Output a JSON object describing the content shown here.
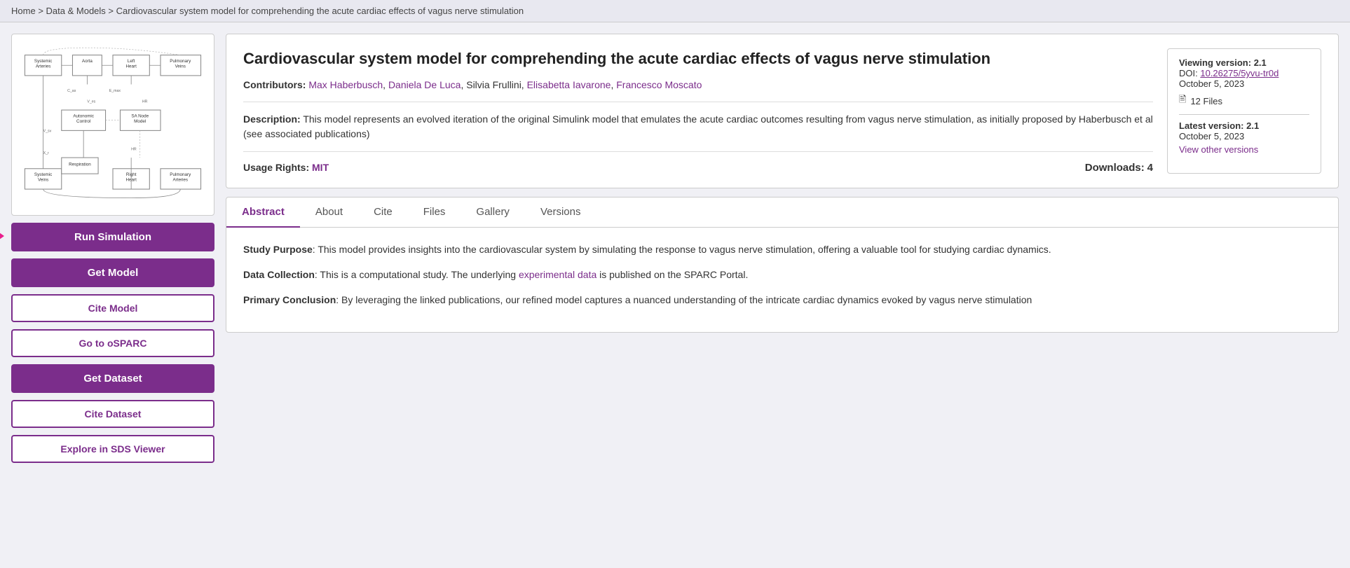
{
  "breadcrumb": {
    "home": "Home",
    "section": "Data & Models",
    "page": "Cardiovascular system model for comprehending the acute cardiac effects of vagus nerve stimulation",
    "separator": ">"
  },
  "model": {
    "title": "Cardiovascular system model for comprehending the acute cardiac effects of vagus nerve stimulation",
    "contributors_label": "Contributors:",
    "contributors": [
      {
        "name": "Max Haberbusch",
        "link": true
      },
      {
        "name": "Daniela De Luca",
        "link": true
      },
      {
        "name": "Silvia Frullini",
        "link": false
      },
      {
        "name": "Elisabetta Iavarone",
        "link": true
      },
      {
        "name": "Francesco Moscato",
        "link": true
      }
    ],
    "description_label": "Description:",
    "description": "This model represents an evolved iteration of the original Simulink model that emulates the acute cardiac outcomes resulting from vagus nerve stimulation, as initially proposed by Haberbusch et al (see associated publications)",
    "usage_rights_label": "Usage Rights:",
    "usage_rights": "MIT",
    "downloads_label": "Downloads:",
    "downloads_count": "4",
    "version_info": {
      "viewing_label": "Viewing version:",
      "viewing_version": "2.1",
      "doi_label": "DOI:",
      "doi": "10.26275/5yvu-tr0d",
      "date": "October 5, 2023",
      "files_count": "12 Files",
      "latest_label": "Latest version:",
      "latest_version": "2.1",
      "latest_date": "October 5, 2023",
      "view_other_versions": "View other versions"
    }
  },
  "tabs": {
    "items": [
      {
        "id": "abstract",
        "label": "Abstract",
        "active": true
      },
      {
        "id": "about",
        "label": "About"
      },
      {
        "id": "cite",
        "label": "Cite"
      },
      {
        "id": "files",
        "label": "Files"
      },
      {
        "id": "gallery",
        "label": "Gallery"
      },
      {
        "id": "versions",
        "label": "Versions"
      }
    ]
  },
  "abstract": {
    "study_purpose_label": "Study Purpose",
    "study_purpose_text": ": This model provides insights into the cardiovascular system by simulating the response to vagus nerve stimulation, offering a valuable tool for studying cardiac dynamics.",
    "data_collection_label": "Data Collection",
    "data_collection_text": ": This is a computational study. The underlying ",
    "exp_data_link": "experimental data",
    "data_collection_text2": " is published on the SPARC Portal.",
    "primary_conclusion_label": "Primary Conclusion",
    "primary_conclusion_text": ": By leveraging the linked publications, our refined model captures a nuanced understanding of the intricate cardiac dynamics evoked by vagus nerve stimulation"
  },
  "sidebar": {
    "run_simulation": "Run Simulation",
    "get_model": "Get Model",
    "cite_model": "Cite Model",
    "go_to_osparc": "Go to oSPARC",
    "get_dataset": "Get Dataset",
    "cite_dataset": "Cite Dataset",
    "explore_sds": "Explore in SDS Viewer"
  },
  "icons": {
    "files_icon": "📄",
    "arrow_icon": "→"
  }
}
